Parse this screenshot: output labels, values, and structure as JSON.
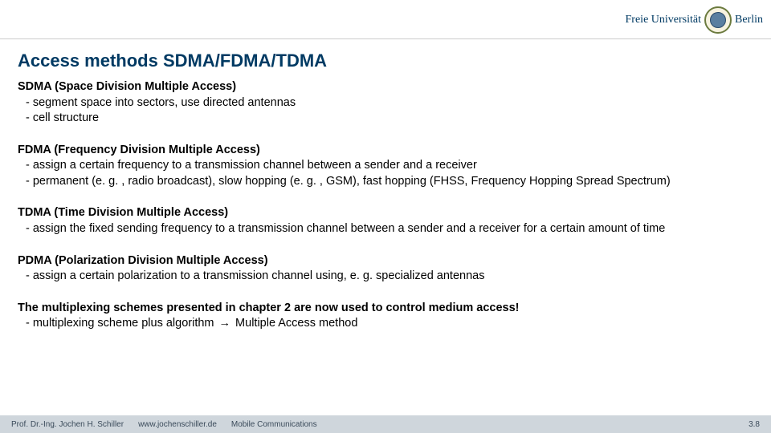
{
  "header": {
    "logo_left": "Freie Universität",
    "logo_right": "Berlin"
  },
  "title": "Access methods SDMA/FDMA/TDMA",
  "sections": [
    {
      "heading": "SDMA (Space Division Multiple Access)",
      "bullets": [
        "segment space into sectors, use directed antennas",
        "cell structure"
      ]
    },
    {
      "heading": "FDMA (Frequency Division Multiple Access)",
      "bullets": [
        "assign a certain frequency to a transmission channel between a sender and a receiver",
        "permanent (e. g. , radio broadcast), slow hopping (e. g. , GSM), fast hopping (FHSS, Frequency Hopping Spread Spectrum)"
      ]
    },
    {
      "heading": "TDMA (Time Division Multiple Access)",
      "bullets": [
        "assign the fixed sending frequency to a transmission channel between a sender and a receiver for a certain amount of time"
      ]
    },
    {
      "heading": "PDMA (Polarization Division Multiple Access)",
      "bullets": [
        "assign a certain polarization to a transmission channel using, e. g. specialized antennas"
      ]
    },
    {
      "heading": "The multiplexing schemes presented in chapter 2 are now used to control medium access!",
      "arrow_bullet": {
        "pre": "multiplexing scheme plus algorithm ",
        "post": " Multiple Access method"
      }
    }
  ],
  "footer": {
    "author": "Prof. Dr.-Ing. Jochen H. Schiller",
    "url": "www.jochenschiller.de",
    "course": "Mobile Communications",
    "page": "3.8"
  },
  "glyphs": {
    "dash": "-",
    "arrow": "→"
  }
}
